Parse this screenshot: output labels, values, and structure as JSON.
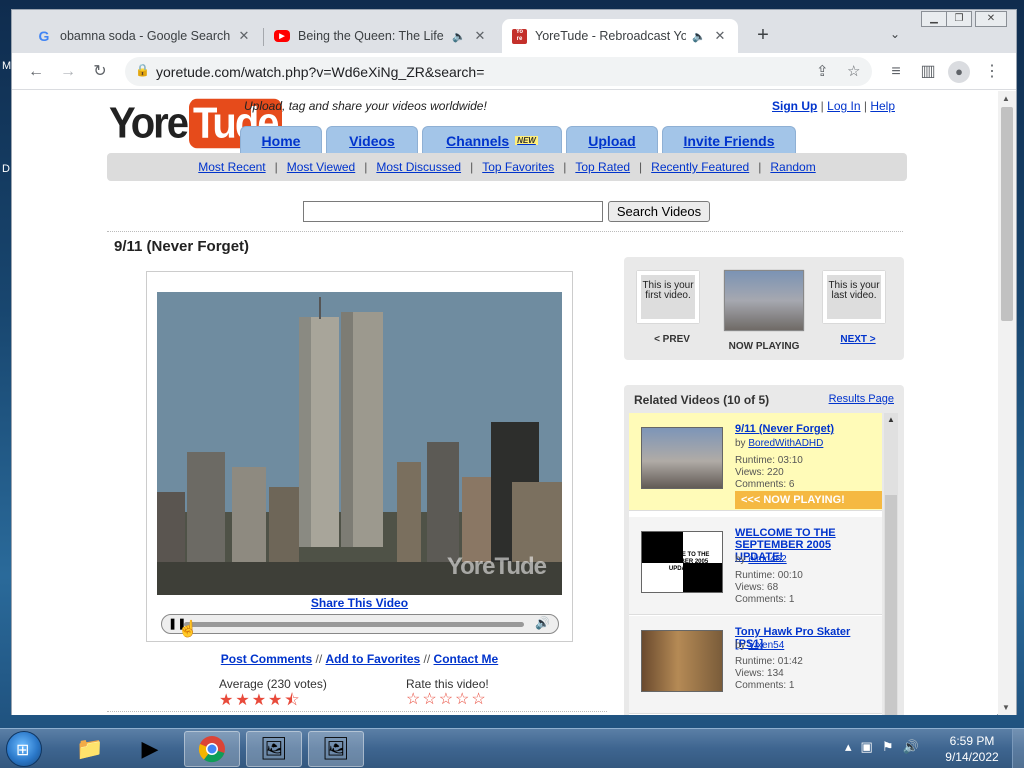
{
  "desktop": {
    "glyph_m": "M",
    "glyph_d": "D"
  },
  "browser": {
    "tabs": [
      {
        "title": "obamna soda - Google Search",
        "favicon": "google-icon"
      },
      {
        "title": "Being the Queen: The Life of",
        "favicon": "youtube-icon"
      },
      {
        "title": "YoreTude - Rebroadcast Your",
        "favicon": "yoretude-icon"
      }
    ],
    "url": "yoretude.com/watch.php?v=Wd6eXiNg_ZR&search="
  },
  "site": {
    "logo_left": "Yore",
    "logo_right": "Tude",
    "tagline": "Upload, tag and share your videos worldwide!",
    "top_links": {
      "signup": "Sign Up",
      "login": "Log In",
      "help": "Help"
    },
    "nav": [
      {
        "label": "Home"
      },
      {
        "label": "Videos"
      },
      {
        "label": "Channels",
        "badge": "NEW"
      },
      {
        "label": "Upload"
      },
      {
        "label": "Invite Friends"
      }
    ],
    "subnav": [
      "Most Recent",
      "Most Viewed",
      "Most Discussed",
      "Top Favorites",
      "Top Rated",
      "Recently Featured",
      "Random"
    ],
    "search": {
      "value": "",
      "button": "Search Videos"
    }
  },
  "video": {
    "title": "9/11 (Never Forget)",
    "watermark": "YoreTude",
    "share": "Share This Video",
    "actions": [
      "Post Comments",
      "Add to Favorites",
      "Contact Me"
    ],
    "average_label": "Average (230 votes)",
    "average_rating": 4.5,
    "rate_label": "Rate this video!",
    "stars_on": "★★★★⯪",
    "stars_off": "☆☆☆☆☆"
  },
  "player_nav": {
    "prev_thumb": "This is your first video.",
    "prev_label": "< PREV",
    "now_label": "NOW PLAYING",
    "next_thumb": "This is your last video.",
    "next_label": "NEXT >"
  },
  "related": {
    "header": "Related Videos (10 of 5)",
    "results_link": "Results Page",
    "items": [
      {
        "title": "9/11 (Never Forget)",
        "by_prefix": "by ",
        "user": "BoredWithADHD",
        "runtime": "Runtime: 03:10",
        "views": "Views: 220",
        "comments": "Comments: 6",
        "now_playing": "<<< NOW PLAYING!"
      },
      {
        "title": "WELCOME TO THE SEPTEMBER 2005 UPDATE!",
        "by_prefix": "by ",
        "user": "elmo452",
        "runtime": "Runtime: 00:10",
        "views": "Views: 68",
        "comments": "Comments: 1",
        "thumb_text": "WELCOME TO THE SEPTEMBER 2005 UPDATE!"
      },
      {
        "title": "Tony Hawk Pro Skater [PS1]",
        "by_prefix": "by ",
        "user": "Vixen54",
        "runtime": "Runtime: 01:42",
        "views": "Views: 134",
        "comments": "Comments: 1"
      }
    ]
  },
  "taskbar": {
    "time": "6:59 PM",
    "date": "9/14/2022"
  }
}
